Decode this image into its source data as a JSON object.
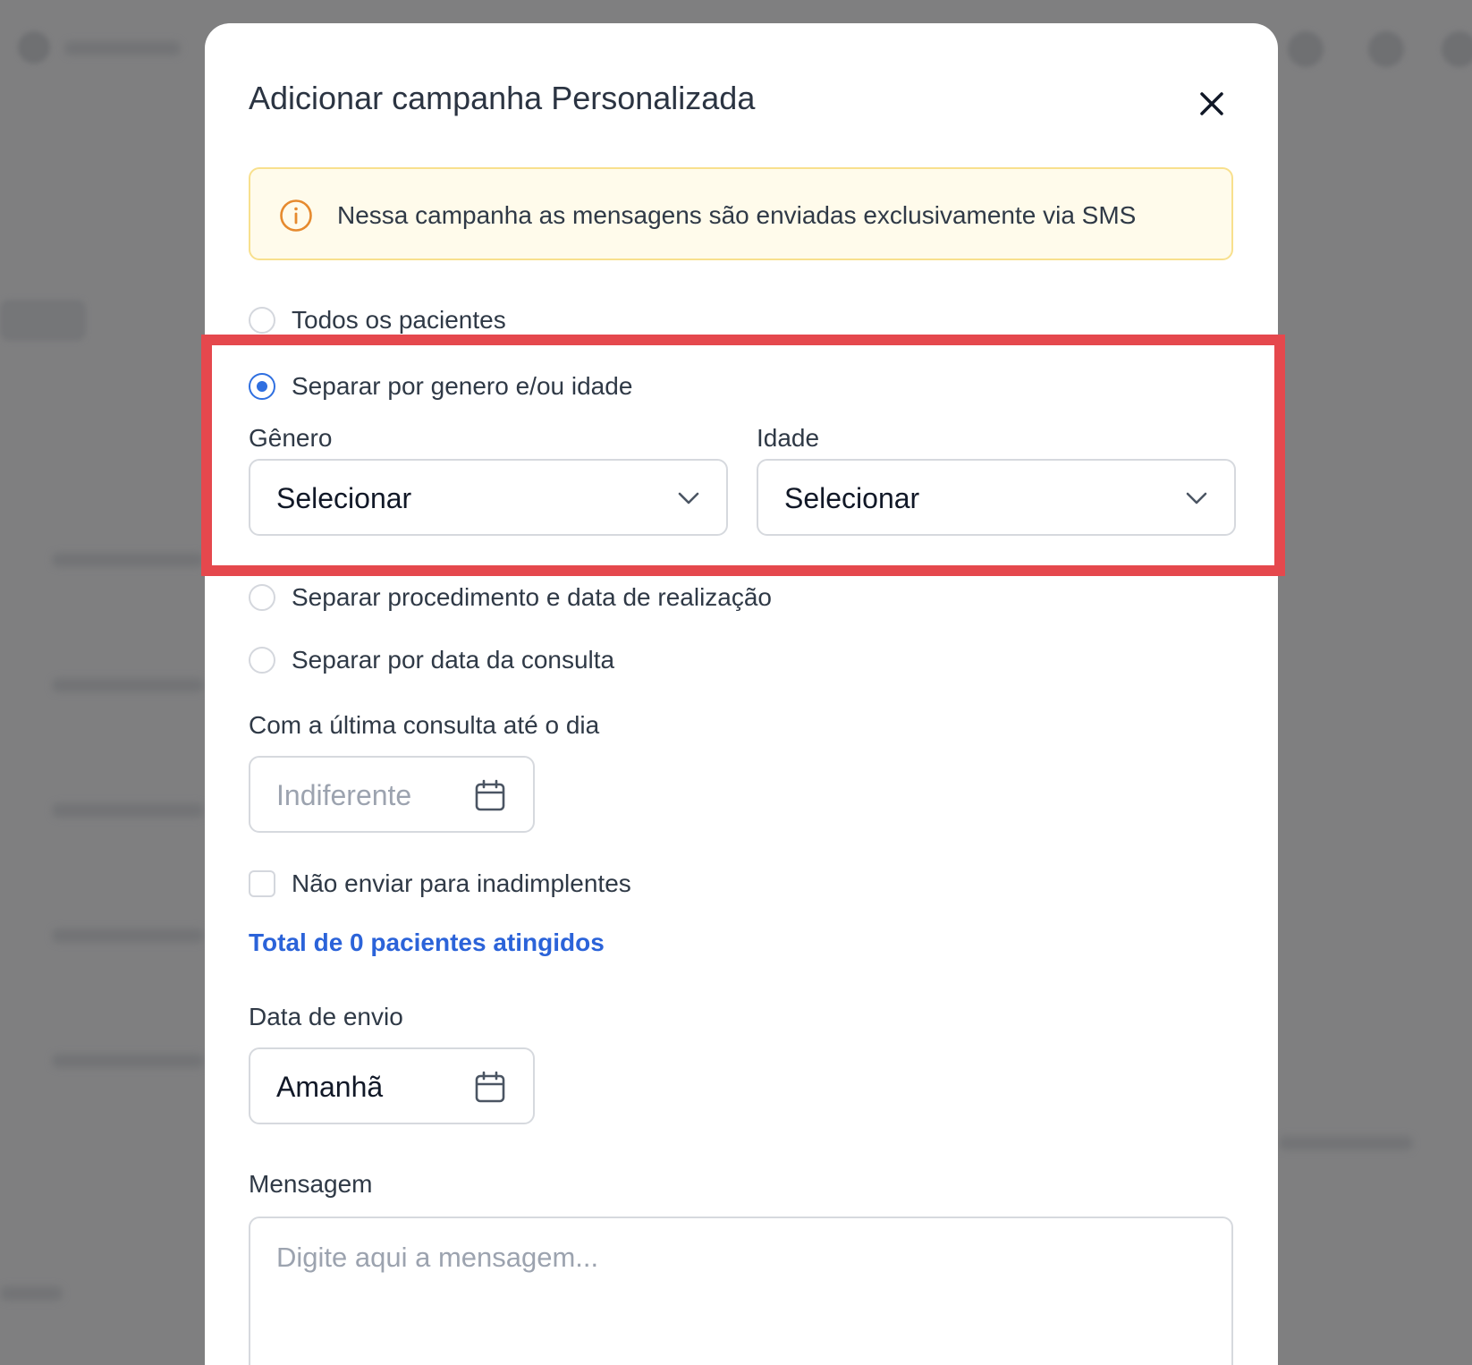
{
  "modal": {
    "title": "Adicionar campanha Personalizada",
    "close_icon": "close-icon"
  },
  "alert": {
    "icon": "info-icon",
    "text": "Nessa campanha as mensagens são enviadas exclusivamente via SMS",
    "accent_color": "#e68a2e"
  },
  "audience": {
    "options": [
      {
        "label": "Todos os pacientes",
        "selected": false
      },
      {
        "label": "Separar por genero e/ou idade",
        "selected": true
      },
      {
        "label": "Separar procedimento e data de realização",
        "selected": false
      },
      {
        "label": "Separar por data da consulta",
        "selected": false
      }
    ]
  },
  "filters": {
    "gender_label": "Gênero",
    "gender_value": "Selecionar",
    "age_label": "Idade",
    "age_value": "Selecionar"
  },
  "last_visit": {
    "label": "Com a última consulta até o dia",
    "placeholder": "Indiferente",
    "icon": "calendar-icon"
  },
  "exclude_defaulters": {
    "label": "Não enviar para inadimplentes",
    "checked": false
  },
  "total_link": "Total de 0 pacientes atingidos",
  "send_date": {
    "label": "Data de envio",
    "value": "Amanhã",
    "icon": "calendar-icon"
  },
  "message": {
    "label": "Mensagem",
    "placeholder": "Digite aqui a mensagem..."
  },
  "colors": {
    "primary": "#2f6fe0",
    "link": "#2b63d9",
    "highlight": "#e5484d",
    "alert_bg": "#fffbeb",
    "alert_border": "#f8e08d"
  }
}
